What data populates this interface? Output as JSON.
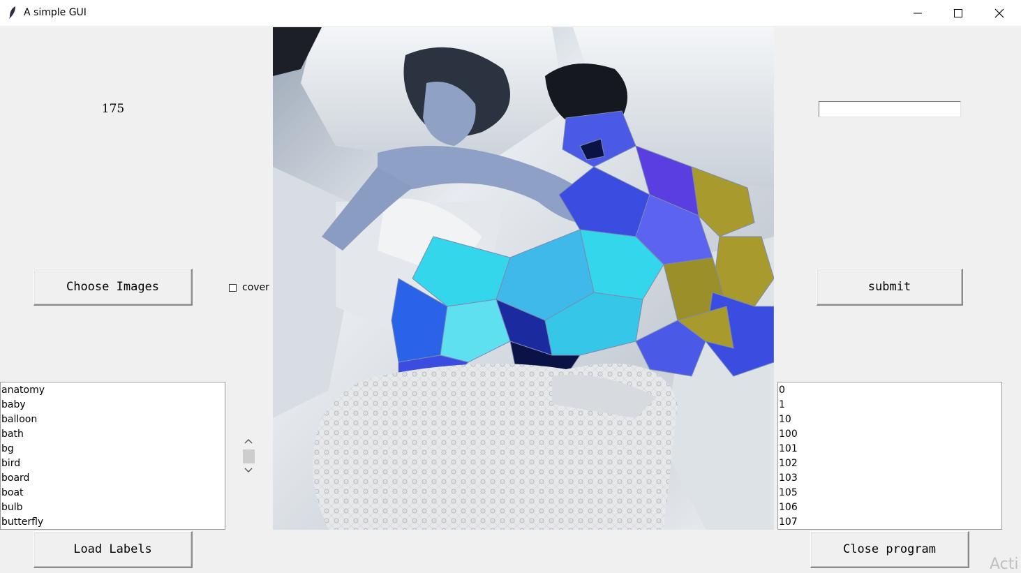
{
  "window": {
    "title": "A simple GUI",
    "controls": {
      "minimize_icon": "minimize-icon",
      "maximize_icon": "maximize-icon",
      "close_icon": "close-icon"
    }
  },
  "left_panel": {
    "count_label": "175",
    "choose_images_button": "Choose Images",
    "load_labels_button": "Load Labels",
    "labels": [
      "anatomy",
      "baby",
      "balloon",
      "bath",
      "bg",
      "bird",
      "board",
      "boat",
      "bulb",
      "butterfly"
    ]
  },
  "center": {
    "cover_checkbox": {
      "label": "cover",
      "checked": false
    },
    "image_description": "Photo of two people sleeping in white satin sheets, with a multicolored low-poly geometric overlay covering one figure"
  },
  "right_panel": {
    "entry_value": "",
    "submit_button": "submit",
    "close_program_button": "Close program",
    "items": [
      "0",
      "1",
      "10",
      "100",
      "101",
      "102",
      "103",
      "105",
      "106",
      "107"
    ]
  },
  "overlay": {
    "watermark_text": "Acti"
  },
  "colors": {
    "window_bg": "#f0f0f0",
    "poly_blue": "#3a4de0",
    "poly_cyan": "#34d6ec",
    "poly_olive": "#a89a2c",
    "poly_dark": "#0a1246"
  }
}
